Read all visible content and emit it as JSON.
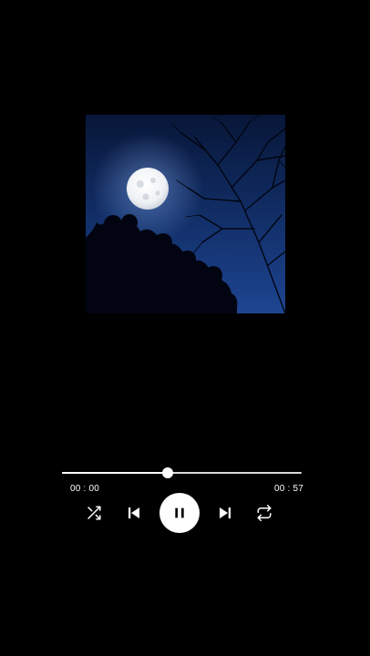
{
  "player": {
    "artwork": {
      "description_icon": "album-artwork-moon-night"
    },
    "progress": {
      "fraction": 0.44,
      "elapsed": "00 : 00",
      "total": "00 : 57"
    },
    "controls": {
      "shuffle_icon": "shuffle-icon",
      "previous_icon": "skip-previous-icon",
      "pause_icon": "pause-icon",
      "next_icon": "skip-next-icon",
      "repeat_icon": "repeat-icon"
    },
    "colors": {
      "background": "#000000",
      "foreground": "#ffffff",
      "sky_top": "#061233",
      "sky_bottom": "#1b3f86"
    }
  }
}
